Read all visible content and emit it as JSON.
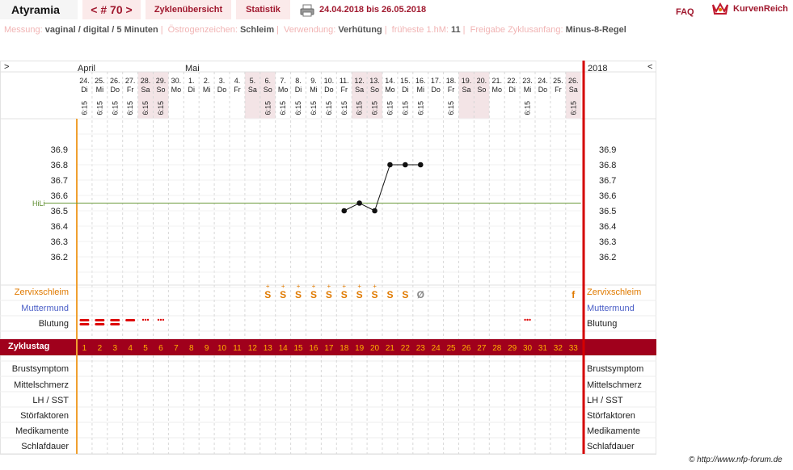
{
  "header": {
    "brand": "Atyramia",
    "cycle_nav": "< # 70 >",
    "tab_overview": "Zyklenübersicht",
    "tab_stats": "Statistik",
    "date_range": "24.04.2018 bis 26.05.2018",
    "faq": "FAQ",
    "logo_text": "KurvenReich",
    "print_icon": "printer-icon",
    "logo_icon": "crown-icon"
  },
  "settings": {
    "messung_label": "Messung:",
    "messung_value": "vaginal / digital / 5 Minuten",
    "oestrogen_label": "Östrogenzeichen:",
    "oestrogen_value": "Schleim",
    "verwendung_label": "Verwendung:",
    "verwendung_value": "Verhütung",
    "frueheste_label": "früheste 1.hM:",
    "frueheste_value": "11",
    "freigabe_label": "Freigabe Zyklusanfang:",
    "freigabe_value": "Minus-8-Regel"
  },
  "chart": {
    "nav_left": ">",
    "nav_right": "<",
    "month_april": "April",
    "month_mai": "Mai",
    "year": "2018",
    "hili_label": "HiLi",
    "hili_value": 36.55,
    "row_labels": {
      "cervix": "Zervixschleim",
      "mumu": "Muttermund",
      "blood": "Blutung",
      "cycle_day": "Zyklustag",
      "breast": "Brustsymptom",
      "midpain": "Mittelschmerz",
      "lh": "LH / SST",
      "disturb": "Störfaktoren",
      "meds": "Medikamente",
      "sleep": "Schlafdauer"
    },
    "days": [
      {
        "d": "24.",
        "wd": "Di",
        "t": "6:15",
        "we": false
      },
      {
        "d": "25.",
        "wd": "Mi",
        "t": "6:15",
        "we": false
      },
      {
        "d": "26.",
        "wd": "Do",
        "t": "6:15",
        "we": false
      },
      {
        "d": "27.",
        "wd": "Fr",
        "t": "6:15",
        "we": false
      },
      {
        "d": "28.",
        "wd": "Sa",
        "t": "6:15",
        "we": true
      },
      {
        "d": "29.",
        "wd": "So",
        "t": "6:15",
        "we": true
      },
      {
        "d": "30.",
        "wd": "Mo",
        "t": "",
        "we": false
      },
      {
        "d": "1.",
        "wd": "Di",
        "t": "",
        "we": false
      },
      {
        "d": "2.",
        "wd": "Mi",
        "t": "",
        "we": false
      },
      {
        "d": "3.",
        "wd": "Do",
        "t": "",
        "we": false
      },
      {
        "d": "4.",
        "wd": "Fr",
        "t": "",
        "we": false
      },
      {
        "d": "5.",
        "wd": "Sa",
        "t": "",
        "we": true
      },
      {
        "d": "6.",
        "wd": "So",
        "t": "6:15",
        "we": true
      },
      {
        "d": "7.",
        "wd": "Mo",
        "t": "6:15",
        "we": false
      },
      {
        "d": "8.",
        "wd": "Di",
        "t": "6:15",
        "we": false
      },
      {
        "d": "9.",
        "wd": "Mi",
        "t": "6:15",
        "we": false
      },
      {
        "d": "10.",
        "wd": "Do",
        "t": "6:15",
        "we": false
      },
      {
        "d": "11.",
        "wd": "Fr",
        "t": "6:15",
        "we": false
      },
      {
        "d": "12.",
        "wd": "Sa",
        "t": "6:15",
        "we": true
      },
      {
        "d": "13.",
        "wd": "So",
        "t": "6:15",
        "we": true
      },
      {
        "d": "14.",
        "wd": "Mo",
        "t": "6:15",
        "we": false
      },
      {
        "d": "15.",
        "wd": "Di",
        "t": "6:15",
        "we": false
      },
      {
        "d": "16.",
        "wd": "Mi",
        "t": "6:15",
        "we": false
      },
      {
        "d": "17.",
        "wd": "Do",
        "t": "",
        "we": false
      },
      {
        "d": "18.",
        "wd": "Fr",
        "t": "6:15",
        "we": false
      },
      {
        "d": "19.",
        "wd": "Sa",
        "t": "",
        "we": true
      },
      {
        "d": "20.",
        "wd": "So",
        "t": "",
        "we": true
      },
      {
        "d": "21.",
        "wd": "Mo",
        "t": "",
        "we": false
      },
      {
        "d": "22.",
        "wd": "Di",
        "t": "",
        "we": false
      },
      {
        "d": "23.",
        "wd": "Mi",
        "t": "6:15",
        "we": false
      },
      {
        "d": "24.",
        "wd": "Do",
        "t": "",
        "we": false
      },
      {
        "d": "25.",
        "wd": "Fr",
        "t": "",
        "we": false
      },
      {
        "d": "26.",
        "wd": "Sa",
        "t": "6:15",
        "we": true
      }
    ],
    "cycle_days": [
      "1",
      "2",
      "3",
      "4",
      "5",
      "6",
      "7",
      "8",
      "9",
      "10",
      "11",
      "12",
      "13",
      "14",
      "15",
      "16",
      "17",
      "18",
      "19",
      "20",
      "21",
      "22",
      "23",
      "24",
      "25",
      "26",
      "27",
      "28",
      "29",
      "30",
      "31",
      "32",
      "33"
    ],
    "cervix_marks": [
      "",
      "",
      "",
      "",
      "",
      "",
      "",
      "",
      "",
      "",
      "",
      "",
      "S+",
      "S+",
      "S+",
      "S+",
      "S+",
      "S+",
      "S+",
      "S+",
      "S",
      "S",
      "Ø",
      "",
      "",
      "",
      "",
      "",
      "",
      "",
      "",
      "",
      "f"
    ],
    "bleeding": [
      "heavy",
      "heavy",
      "heavy",
      "medium",
      "spot",
      "spot",
      "",
      "",
      "",
      "",
      "",
      "",
      "",
      "",
      "",
      "",
      "",
      "",
      "",
      "",
      "",
      "",
      "",
      "",
      "",
      "",
      "",
      "",
      "",
      "spot",
      "",
      "",
      ""
    ],
    "y_ticks": [
      "36.9",
      "36.8",
      "36.7",
      "36.6",
      "36.5",
      "36.4",
      "36.3",
      "36.2"
    ]
  },
  "chart_data": {
    "type": "line",
    "x": [
      "11.05.",
      "12.05.",
      "13.05.",
      "14.05.",
      "15.05.",
      "16.05."
    ],
    "series": [
      {
        "values": [
          36.5,
          36.55,
          36.5,
          36.8,
          36.8,
          36.8
        ]
      }
    ],
    "ylim": [
      36.2,
      36.9
    ],
    "hline": {
      "label": "HiLi",
      "value": 36.55
    }
  },
  "footer": {
    "copyright": "© http://www.nfp-forum.de"
  }
}
